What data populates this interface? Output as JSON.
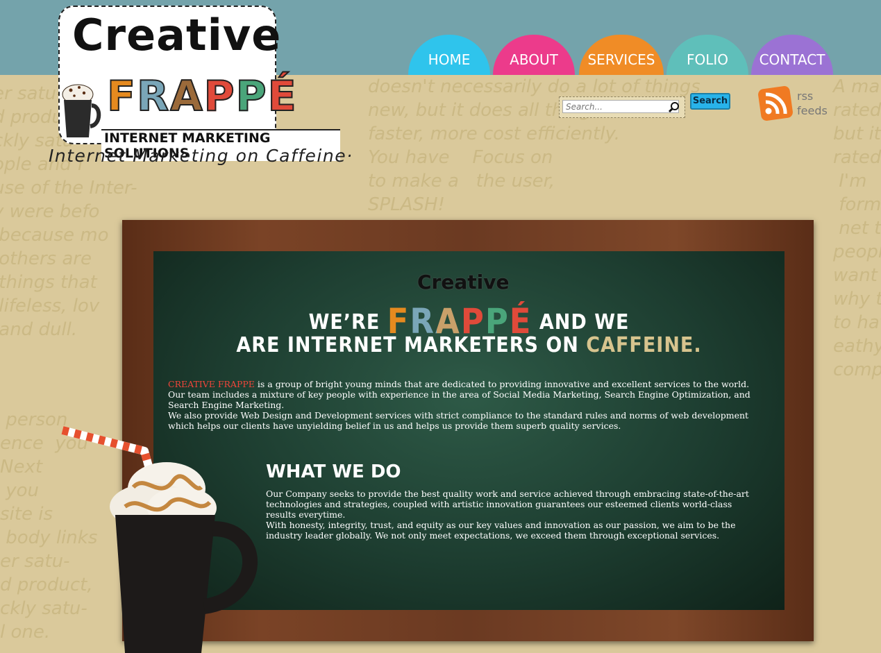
{
  "logo": {
    "creative": "Creative",
    "frappe": "FRAPPÉ",
    "subtitle": "INTERNET MARKETING SOLUTIONS"
  },
  "tagline": "Internet Marketing on Caffeine·",
  "nav": {
    "items": [
      {
        "label": "HOME",
        "color": "#2fc4ec"
      },
      {
        "label": "ABOUT",
        "color": "#ec3b8b"
      },
      {
        "label": "SERVICES",
        "color": "#f08c26"
      },
      {
        "label": "FOLIO",
        "color": "#5fbfba"
      },
      {
        "label": "CONTACT",
        "color": "#9b72d4"
      }
    ]
  },
  "search": {
    "placeholder": "Search...",
    "button_label": "Search"
  },
  "rss": {
    "line1": "rss",
    "line2": "feeds"
  },
  "board": {
    "logo_creative": "Creative",
    "headline_before": "WE’RE",
    "headline_frappe": "FRAPPÉ",
    "headline_after": "AND WE",
    "headline_line2_pre": "ARE INTERNET MARKETERS ON ",
    "headline_line2_highlight": "CAFFEINE.",
    "intro_brand": "CREATIVE FRAPPE",
    "intro_text": " is a group of bright young minds that are dedicated to providing innovative and excellent services to the world. Our team includes a mixture of key people with experience in the area of Social Media Marketing, Search Engine Optimization, and Search Engine Marketing.",
    "paragraph2": "We also provide Web Design and Development services with strict compliance to the standard rules and norms of web development which helps our clients have unyielding belief in us and helps us provide them superb quality services.",
    "what_we_do_heading": "WHAT WE DO",
    "what_we_do_p1": "Our Company seeks to provide the best quality work and service achieved through embracing state-of-the-art technologies and strategies, coupled with artistic innovation guarantees our esteemed clients world-class results everytime.",
    "what_we_do_p2": "With honesty, integrity, trust, and equity as our key values and innovation as our passion, we aim to be the industry leader globally. We not only meet expectations, we exceed them through exceptional services."
  },
  "colors": {
    "accent_red": "#f0453a",
    "caffeine": "#d7c48e",
    "top_band": "#74a3ab",
    "paper": "#dac99b"
  }
}
